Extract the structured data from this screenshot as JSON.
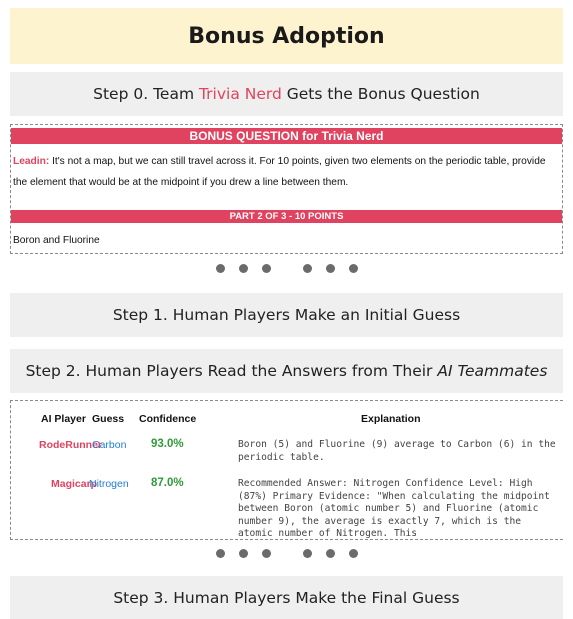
{
  "title": "Bonus Adoption",
  "steps": {
    "step0": {
      "prefix": "Step 0. Team ",
      "team": "Trivia Nerd",
      "suffix": " Gets the Bonus Question"
    },
    "step1": "Step 1. Human Players Make an Initial Guess",
    "step2": {
      "prefix": "Step 2. Human Players Read the Answers from Their ",
      "emph": "AI Teammates"
    },
    "step3": "Step 3. Human Players Make the Final Guess"
  },
  "bonus": {
    "banner": "BONUS QUESTION for Trivia Nerd",
    "leadin_label": "Leadin:",
    "leadin_text": " It's not a map, but we can still travel across it. For 10 points, given two elements on the periodic table, provide the element that would be at the midpoint if you drew a line between them.",
    "part_banner": "PART 2 OF 3 - 10 POINTS",
    "question": "Boron and Fluorine"
  },
  "table": {
    "headers": {
      "player": "AI Player",
      "guess": "Guess",
      "confidence": "Confidence",
      "explanation": "Explanation"
    },
    "rows": [
      {
        "player": "RodeRunner",
        "guess": "Carbon",
        "confidence": "93.0%",
        "explanation": "Boron (5) and Fluorine (9) average to Carbon (6) in the periodic table."
      },
      {
        "player": "Magicarp",
        "guess": "Nitrogen",
        "confidence": "87.0%",
        "explanation": "Recommended Answer: Nitrogen Confidence Level: High (87%) Primary Evidence: \"When calculating the midpoint between Boron (atomic number 5) and Fluorine (atomic number 9), the average is exactly 7, which is the atomic number of Nitrogen. This"
      }
    ]
  },
  "colors": {
    "accent": "#e0435f",
    "title_bg": "#fdf3cf",
    "step_bg": "#efefef",
    "guess": "#1f7ed4",
    "confidence": "#2f9a3a"
  }
}
